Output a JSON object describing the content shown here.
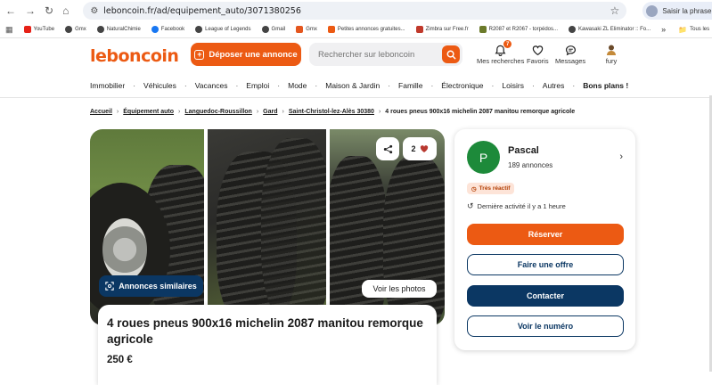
{
  "browser": {
    "url": "leboncoin.fr/ad/equipement_auto/3071380256",
    "incognito_label": "Saisir la phrase secrète"
  },
  "bookmarks": [
    {
      "label": "YouTube",
      "color": "#e62117"
    },
    {
      "label": "Gmx",
      "color": "#444444"
    },
    {
      "label": "NaturalChimie",
      "color": "#444444"
    },
    {
      "label": "Facebook",
      "color": "#1877f2"
    },
    {
      "label": "League of Legends",
      "color": "#444444"
    },
    {
      "label": "Gmail",
      "color": "#444444"
    },
    {
      "label": "Gmx",
      "color": "#e4561e"
    },
    {
      "label": "Petites annonces gratuites...",
      "color": "#ec5a13"
    },
    {
      "label": "Zimbra sur Free.fr",
      "color": "#c0392b"
    },
    {
      "label": "R2087 et R2067 - torpédos...",
      "color": "#6b7a2a"
    },
    {
      "label": "Kawasaki ZL Eliminator :: Fo...",
      "color": "#444444"
    }
  ],
  "bookmarks_right": "Tous les",
  "header": {
    "logo": "leboncoin",
    "deposit_label": "Déposer une annonce",
    "search_placeholder": "Rechercher sur leboncoin",
    "searches_label": "Mes recherches",
    "searches_badge": "7",
    "favorites_label": "Favoris",
    "messages_label": "Messages",
    "user_label": "fury"
  },
  "categories": [
    "Immobilier",
    "Véhicules",
    "Vacances",
    "Emploi",
    "Mode",
    "Maison & Jardin",
    "Famille",
    "Électronique",
    "Loisirs",
    "Autres"
  ],
  "categories_bold": "Bons plans !",
  "breadcrumb": {
    "links": [
      "Accueil",
      "Équipement auto",
      "Languedoc-Roussillon",
      "Gard",
      "Saint-Christol-lez-Alès 30380"
    ],
    "current": "4 roues pneus 900x16 michelin 2087 manitou remorque agricole"
  },
  "gallery": {
    "similar_label": "Annonces similaires",
    "photos_label": "Voir les photos",
    "fav_count": "2"
  },
  "ad": {
    "title": "4 roues pneus 900x16 michelin 2087 manitou remorque agricole",
    "price": "250 €"
  },
  "seller": {
    "initial": "P",
    "name": "Pascal",
    "ads_count": "189 annonces",
    "badge": "Très réactif",
    "activity": "Dernière activité il y a 1 heure",
    "reserve_label": "Réserver",
    "offer_label": "Faire une offre",
    "contact_label": "Contacter",
    "phone_label": "Voir le numéro"
  },
  "colors": {
    "brand_orange": "#ec5a13",
    "navy": "#0b3763",
    "avatar_green": "#1d8a3a"
  }
}
